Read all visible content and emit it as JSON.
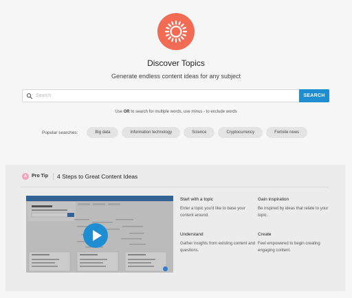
{
  "brand": {
    "accent": "#f26b55",
    "primary": "#1e8dd2",
    "logo_icon": "sun-icon"
  },
  "header": {
    "title": "Discover Topics",
    "subtitle": "Generate endless content ideas for any subject"
  },
  "search": {
    "placeholder": "Search",
    "value": "",
    "button_label": "SEARCH",
    "icon": "search-icon"
  },
  "hint": {
    "before": "Use ",
    "or_word": "OR",
    "after": " to search for multiple words, use minus - to exclude words"
  },
  "popular": {
    "label": "Popular searches:",
    "items": [
      "Big data",
      "Information technology",
      "Science",
      "Cryptocurrency",
      "Fortnite news"
    ]
  },
  "protip": {
    "badge_letter": "A",
    "badge_label": "Pro Tip",
    "heading": "4 Steps to Great Content Ideas",
    "steps": [
      {
        "title": "Start with a topic",
        "text": "Enter a topic you'd like to base your content around."
      },
      {
        "title": "Gain inspiration",
        "text": "Be inspired by ideas that relate to your topic."
      },
      {
        "title": "Understand",
        "text": "Gather insights from existing content and questions."
      },
      {
        "title": "Create",
        "text": "Feel empowered to begin creating engaging content."
      }
    ],
    "video": {
      "play_icon": "play-icon",
      "thumbnail_title": "Discover Topics"
    }
  }
}
